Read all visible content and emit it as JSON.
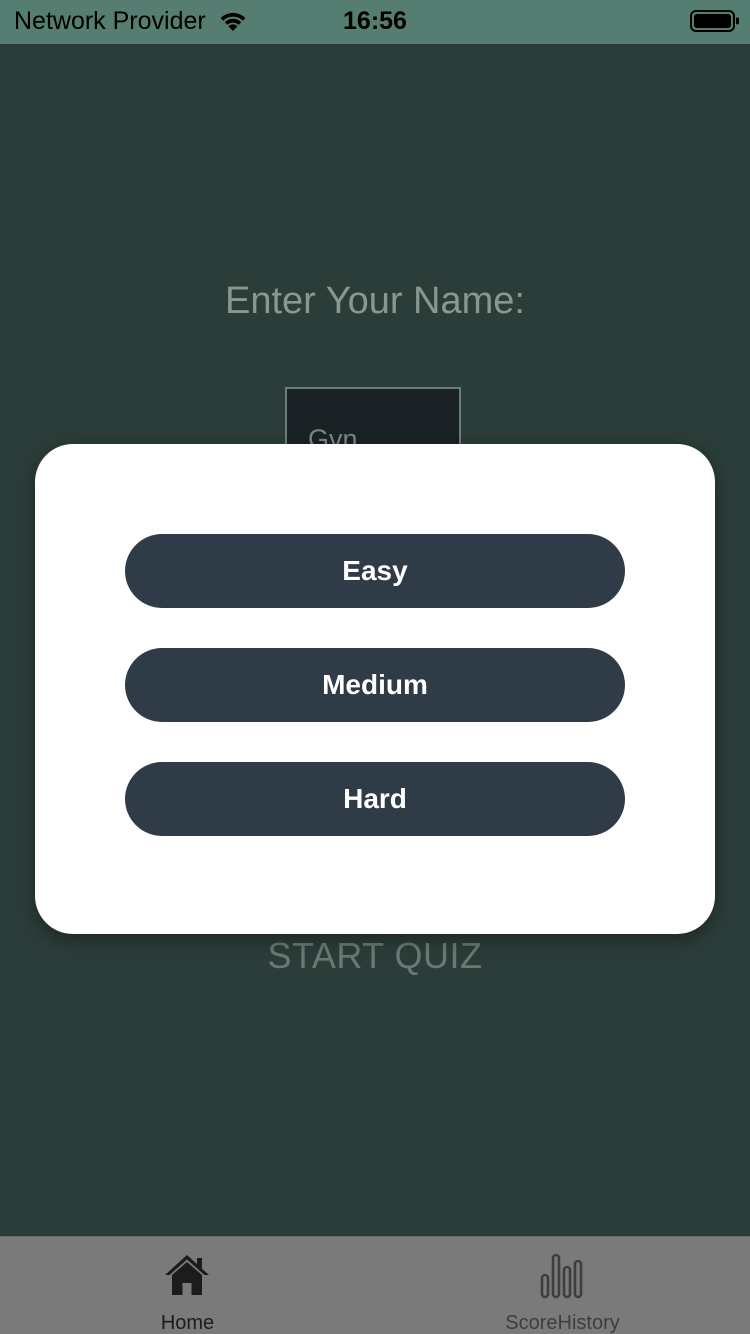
{
  "status_bar": {
    "carrier": "Network Provider",
    "time": "16:56",
    "wifi_icon": "wifi-icon",
    "battery_icon": "battery-icon"
  },
  "main": {
    "prompt": "Enter Your Name:",
    "name_value": "Gvn",
    "start_label": "START QUIZ"
  },
  "modal": {
    "options": [
      {
        "label": "Easy"
      },
      {
        "label": "Medium"
      },
      {
        "label": "Hard"
      }
    ]
  },
  "tab_bar": {
    "tabs": [
      {
        "label": "Home",
        "icon": "home-icon",
        "active": true
      },
      {
        "label": "ScoreHistory",
        "icon": "bar-chart-icon",
        "active": false
      }
    ]
  },
  "colors": {
    "background": "#2b3d39",
    "status_bar": "#567d71",
    "button": "#2f3b47",
    "modal": "#ffffff",
    "tab_bar": "#7a7a7a"
  }
}
